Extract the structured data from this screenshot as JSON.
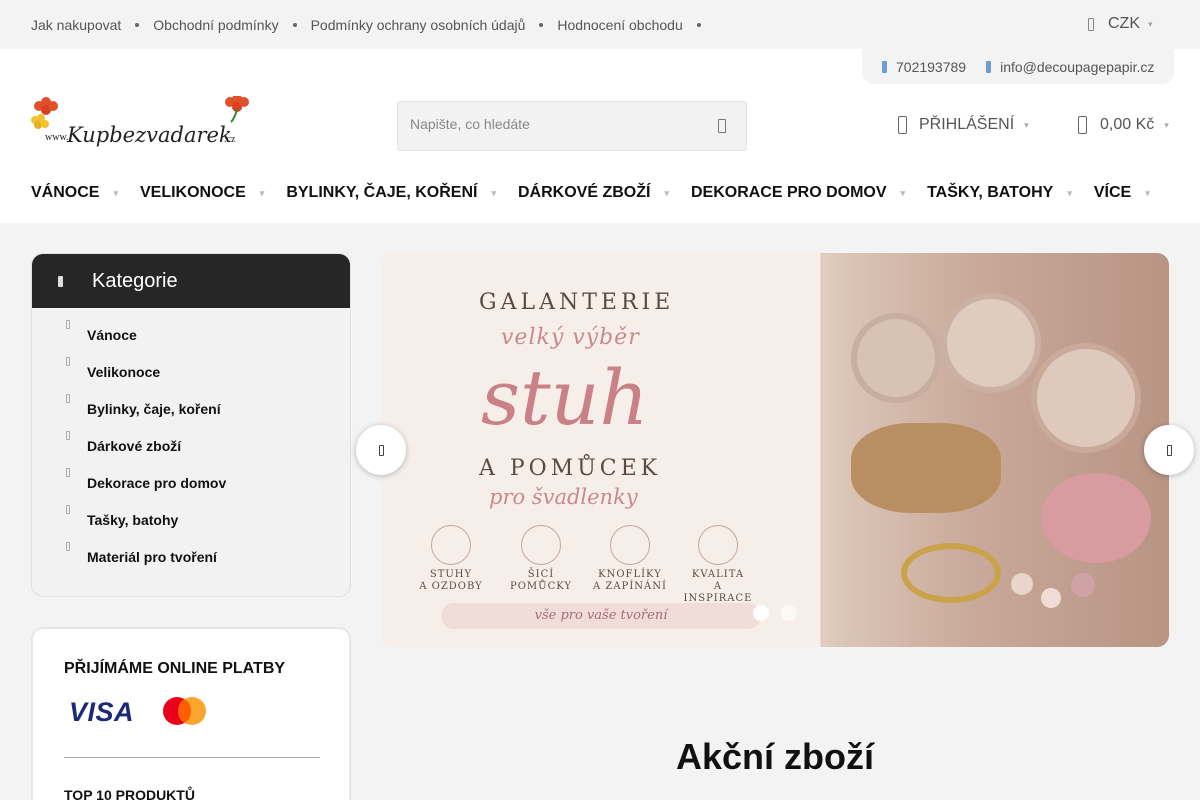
{
  "topbar": {
    "links": [
      "Jak nakupovat",
      "Obchodní podmínky",
      "Podmínky ochrany osobních údajů",
      "Hodnocení obchodu"
    ],
    "currency": "CZK"
  },
  "contact": {
    "phone": "702193789",
    "email": "info@decoupagepapir.cz"
  },
  "logo": {
    "text_prefix": "www.",
    "text_main": "Kupbezvadarek",
    "text_suffix": ".cz"
  },
  "search": {
    "placeholder": "Napište, co hledáte",
    "value": ""
  },
  "account": {
    "login_label": "PŘIHLÁŠENÍ"
  },
  "cart": {
    "total": "0,00 Kč"
  },
  "main_nav": [
    "VÁNOCE",
    "VELIKONOCE",
    "BYLINKY, ČAJE, KOŘENÍ",
    "DÁRKOVÉ ZBOŽÍ",
    "DEKORACE PRO DOMOV",
    "TAŠKY, BATOHY",
    "VÍCE"
  ],
  "categories": {
    "title": "Kategorie",
    "items": [
      "Vánoce",
      "Velikonoce",
      "Bylinky, čaje, koření",
      "Dárkové zboží",
      "Dekorace pro domov",
      "Tašky, batohy",
      "Materiál pro tvoření"
    ]
  },
  "payments": {
    "title": "PŘIJÍMÁME ONLINE PLATBY",
    "visa_label": "VISA",
    "top10_title": "TOP 10 PRODUKTŮ"
  },
  "banner": {
    "line1": "GALANTERIE",
    "line2": "velký výběr",
    "line3": "stuh",
    "line4": "A POMŮCEK",
    "line5": "pro švadlenky",
    "features": [
      {
        "l1": "STUHY",
        "l2": "A OZDOBY"
      },
      {
        "l1": "ŠICÍ",
        "l2": "POMŮCKY"
      },
      {
        "l1": "KNOFLÍKY",
        "l2": "A ZAPÍNÁNÍ"
      },
      {
        "l1": "KVALITA",
        "l2": "A INSPIRACE"
      }
    ],
    "bottom": "vše pro vaše tvoření",
    "slides": 2,
    "active_slide": 1
  },
  "section": {
    "title": "Akční zboží"
  },
  "colors": {
    "header_dark": "#262626",
    "banner_pink": "#c98086",
    "visa_blue": "#1a2a78"
  }
}
